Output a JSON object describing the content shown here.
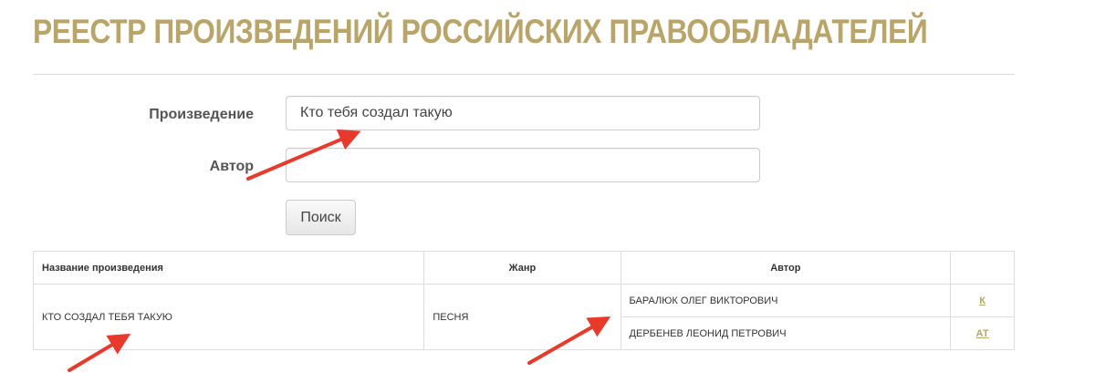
{
  "header": {
    "title": "РЕЕСТР ПРОИЗВЕДЕНИЙ РОССИЙСКИХ ПРАВООБЛАДАТЕЛЕЙ"
  },
  "search_form": {
    "work_label": "Произведение",
    "work_value": "Кто тебя создал такую",
    "author_label": "Автор",
    "author_value": "",
    "search_button": "Поиск"
  },
  "results_table": {
    "headers": {
      "title": "Название произведения",
      "genre": "Жанр",
      "author": "Автор",
      "role": ""
    },
    "rows": [
      {
        "title": "КТО СОЗДАЛ ТЕБЯ ТАКУЮ",
        "genre": "ПЕСНЯ",
        "authors": [
          {
            "name": "БАРАЛЮК ОЛЕГ ВИКТОРОВИЧ",
            "role": "К"
          },
          {
            "name": "ДЕРБЕНЕВ ЛЕОНИД ПЕТРОВИЧ",
            "role": "АТ"
          }
        ]
      }
    ]
  },
  "colors": {
    "title_gold": "#b9a56a",
    "link_gold": "#b9a56a",
    "annotation_arrow": "#e8392b"
  }
}
